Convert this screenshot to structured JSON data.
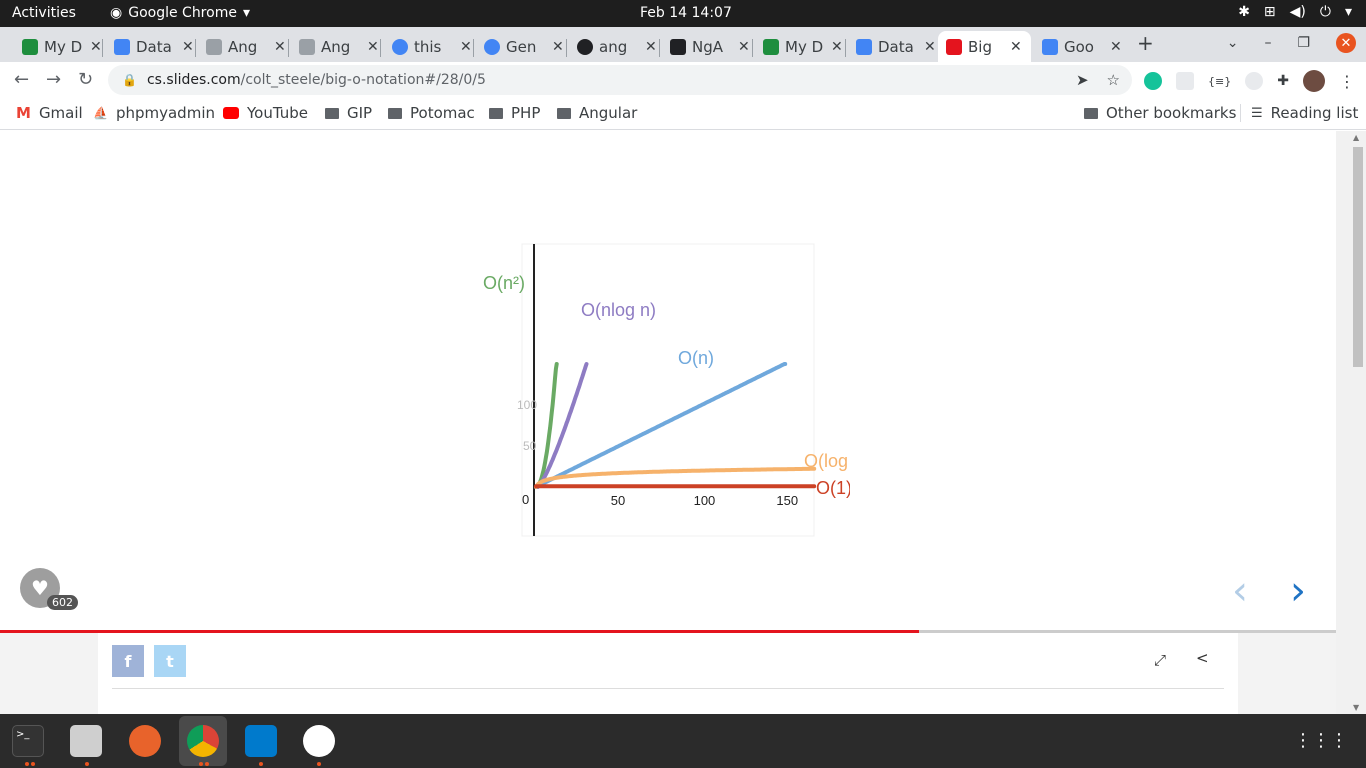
{
  "topbar": {
    "activities": "Activities",
    "app_name": "Google Chrome",
    "clock": "Feb 14  14:07"
  },
  "tabs": [
    {
      "title": "My D",
      "favicon_color": "#1e8e3e"
    },
    {
      "title": "Data",
      "favicon_color": "#4285f4"
    },
    {
      "title": "Ang",
      "favicon_color": "#9aa0a6"
    },
    {
      "title": "Ang",
      "favicon_color": "#9aa0a6"
    },
    {
      "title": "this",
      "favicon_color": "#4285f4"
    },
    {
      "title": "Gen",
      "favicon_color": "#4285f4"
    },
    {
      "title": "ang",
      "favicon_color": "#202124"
    },
    {
      "title": "NgA",
      "favicon_color": "#202124"
    },
    {
      "title": "My D",
      "favicon_color": "#1e8e3e"
    },
    {
      "title": "Data",
      "favicon_color": "#4285f4"
    },
    {
      "title": "Big",
      "favicon_color": "#e4141e"
    },
    {
      "title": "Goo",
      "favicon_color": "#4285f4"
    }
  ],
  "address": {
    "domain": "cs.slides.com",
    "path": "/colt_steele/big-o-notation#/28/0/5"
  },
  "bookmarks": {
    "items": [
      "Gmail",
      "phpmyadmin",
      "YouTube",
      "GIP",
      "Potomac",
      "PHP",
      "Angular"
    ],
    "other": "Other bookmarks",
    "reading_list": "Reading list"
  },
  "slide": {
    "likes": "602",
    "progress_fraction": 0.688
  },
  "chart_data": {
    "type": "line",
    "title": "",
    "xlabel": "",
    "ylabel": "",
    "x_ticks": [
      "0",
      "50",
      "100",
      "150"
    ],
    "y_ticks": [
      "50",
      "100"
    ],
    "xlim": [
      0,
      170
    ],
    "ylim": [
      0,
      145
    ],
    "series": [
      {
        "name": "O(n²)",
        "color": "#6aaa64"
      },
      {
        "name": "O(nlog n)",
        "color": "#8e7cc3"
      },
      {
        "name": "O(n)",
        "color": "#6fa8dc"
      },
      {
        "name": "O(log n)",
        "color": "#f6b26b"
      },
      {
        "name": "O(1)",
        "color": "#cc4125"
      }
    ]
  },
  "colors": {
    "accent": "#1f73c4",
    "progress": "#e4141e"
  }
}
